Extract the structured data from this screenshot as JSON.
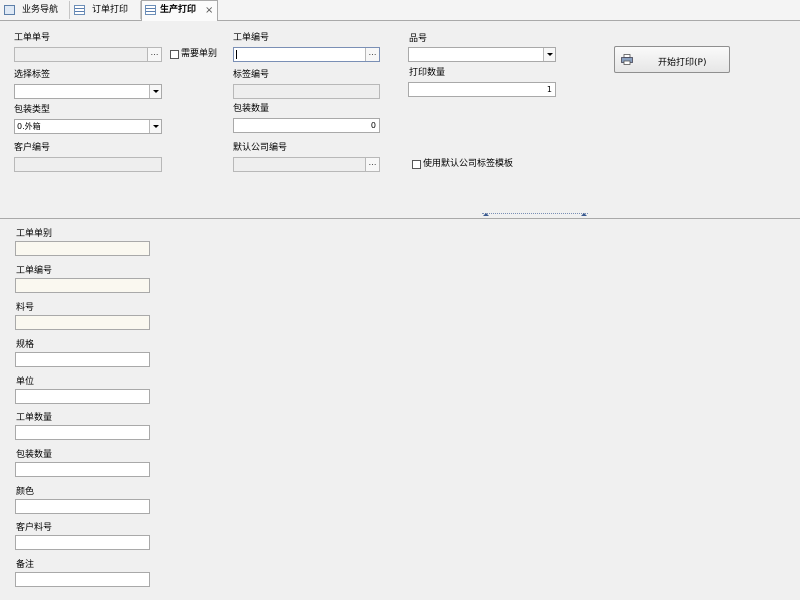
{
  "tabs": [
    {
      "label": "业务导航",
      "icon": "navigation-icon"
    },
    {
      "label": "订单打印",
      "icon": "list-icon"
    },
    {
      "label": "生产打印",
      "icon": "list-icon",
      "active": true,
      "close": "×"
    }
  ],
  "top_form": {
    "work_order_no": {
      "label": "工单单号",
      "value": ""
    },
    "need_single_type": {
      "label": "需要单别",
      "checked": false
    },
    "select_label": {
      "label": "选择标签",
      "value": ""
    },
    "package_type": {
      "label": "包装类型",
      "value": "0.外箱"
    },
    "customer_no": {
      "label": "客户编号",
      "value": ""
    },
    "work_order_code": {
      "label": "工单编号",
      "value": ""
    },
    "label_code": {
      "label": "标签编号",
      "value": ""
    },
    "package_qty": {
      "label": "包装数量",
      "value": "0"
    },
    "default_company_code": {
      "label": "默认公司编号",
      "value": ""
    },
    "item_no": {
      "label": "品号",
      "value": ""
    },
    "print_qty": {
      "label": "打印数量",
      "value": "1"
    },
    "use_default_template": {
      "label": "使用默认公司标签模板",
      "checked": false
    },
    "start_print_button": {
      "label": "开始打印(P)",
      "icon": "printer-icon"
    },
    "ellipsis": "…"
  },
  "detail_form": [
    {
      "label": "工单单别",
      "value": ""
    },
    {
      "label": "工单编号",
      "value": ""
    },
    {
      "label": "料号",
      "value": ""
    },
    {
      "label": "规格",
      "value": ""
    },
    {
      "label": "单位",
      "value": ""
    },
    {
      "label": "工单数量",
      "value": ""
    },
    {
      "label": "包装数量",
      "value": ""
    },
    {
      "label": "颜色",
      "value": ""
    },
    {
      "label": "客户料号",
      "value": ""
    },
    {
      "label": "备注",
      "value": ""
    }
  ],
  "colors": {
    "background": "#f0f0f0",
    "readonly_field": "#eeeeee",
    "cream_field": "#faf8f0",
    "border": "#a9a9a9"
  }
}
